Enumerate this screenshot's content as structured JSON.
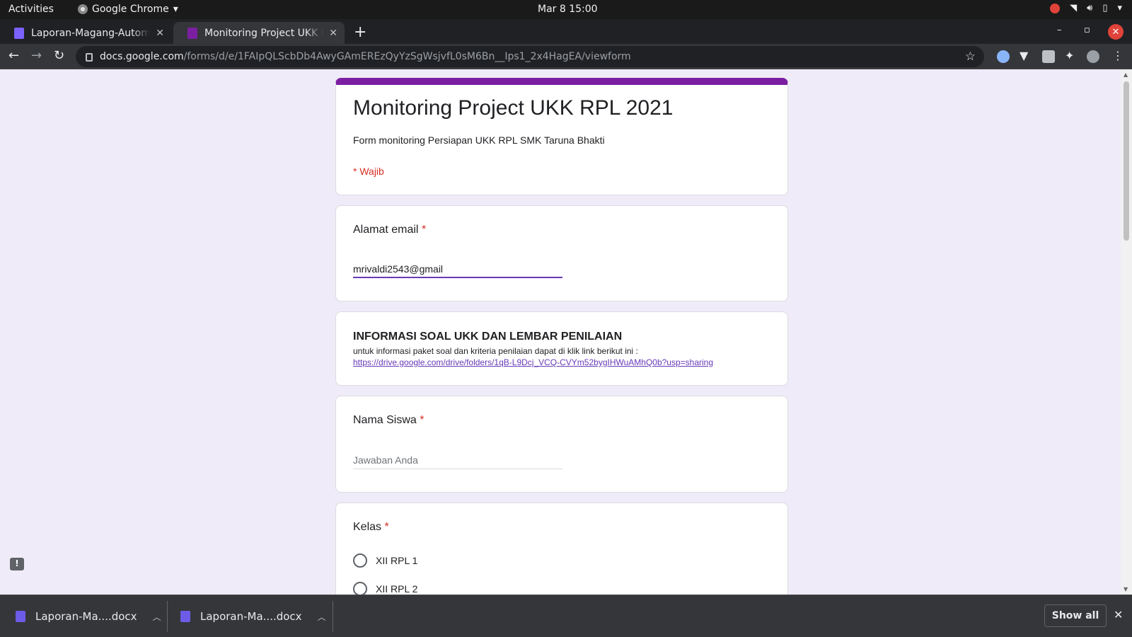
{
  "system": {
    "activities": "Activities",
    "app_name": "Google Chrome",
    "datetime": "Mar 8  15:00"
  },
  "tabs": [
    {
      "title": "Laporan-Magang-Automa",
      "active": false
    },
    {
      "title": "Monitoring Project UKK R",
      "active": true
    }
  ],
  "address_bar": {
    "host": "docs.google.com",
    "path": "/forms/d/e/1FAIpQLScbDb4AwyGAmEREzQyYzSgWsjvfL0sM6Bn__Ips1_2x4HagEA/viewform"
  },
  "form": {
    "title": "Monitoring Project UKK RPL 2021",
    "description": "Form monitoring Persiapan UKK RPL SMK Taruna Bhakti",
    "required_note": "* Wajib",
    "email_question": {
      "label": "Alamat email",
      "value": "mrivaldi2543@gmail"
    },
    "info_section": {
      "heading": "INFORMASI SOAL UKK DAN LEMBAR PENILAIAN",
      "text": "untuk informasi paket soal dan kriteria penilaian dapat di klik link berikut ini :",
      "link": "https://drive.google.com/drive/folders/1qB-L9Dcj_VCQ-CVYm52bygIHWuAMhQ0b?usp=sharing"
    },
    "name_question": {
      "label": "Nama Siswa",
      "placeholder": "Jawaban Anda"
    },
    "class_question": {
      "label": "Kelas",
      "options": [
        "XII RPL 1",
        "XII RPL 2"
      ]
    },
    "required_marker": "*"
  },
  "downloads": {
    "items": [
      "Laporan-Ma....docx",
      "Laporan-Ma....docx"
    ],
    "show_all": "Show all"
  },
  "colors": {
    "form_accent": "#7b1fa2",
    "page_bg": "#f0ebf8",
    "required_red": "#d93025"
  }
}
